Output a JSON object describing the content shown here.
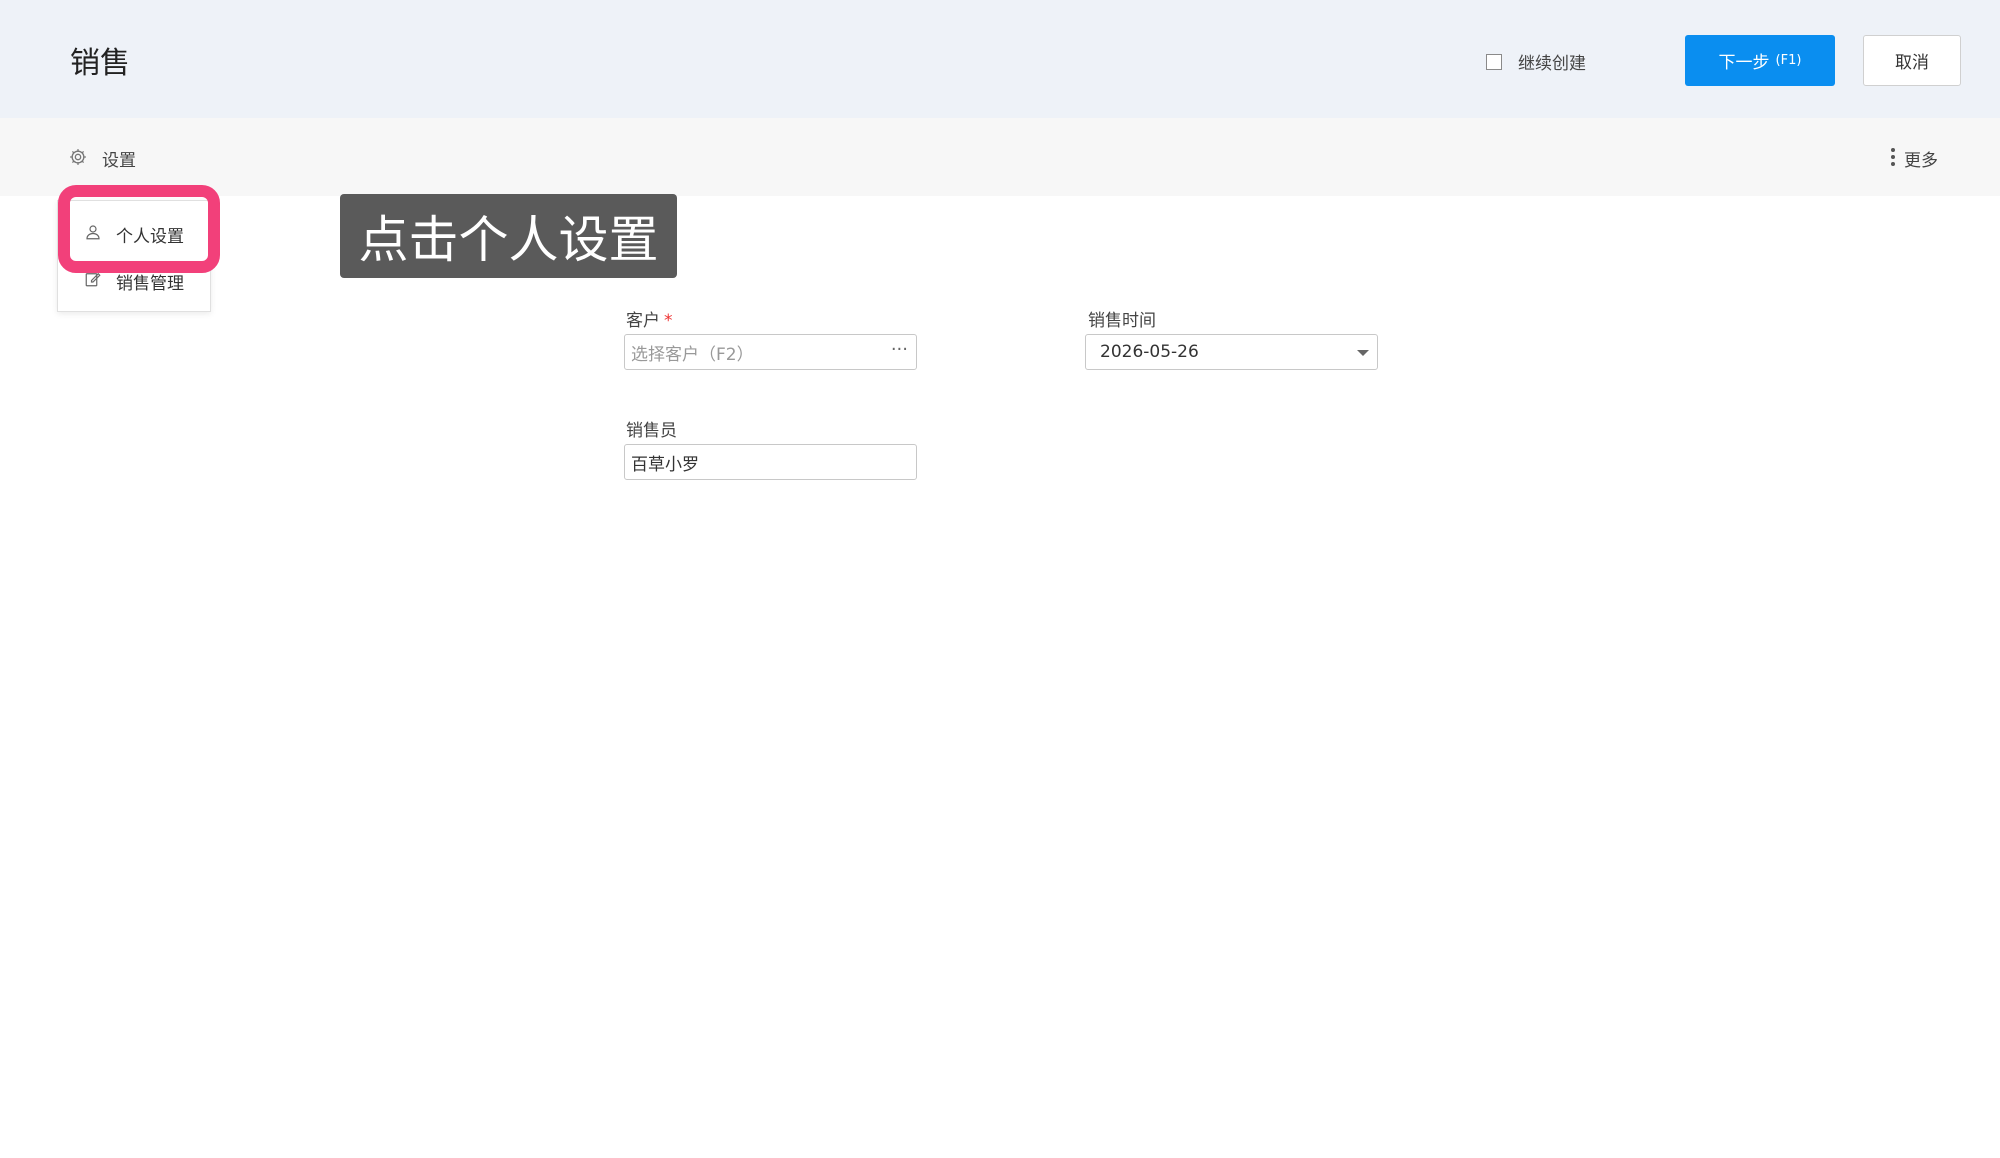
{
  "header": {
    "title": "销售",
    "continue_create": "继续创建",
    "next_label": "下一步",
    "next_shortcut": "(F1)",
    "cancel_label": "取消"
  },
  "toolbar": {
    "settings_label": "设置",
    "more_label": "更多"
  },
  "dropdown": {
    "items": [
      {
        "label": "个人设置"
      },
      {
        "label": "销售管理"
      }
    ]
  },
  "tooltip": {
    "text": "点击个人设置"
  },
  "form": {
    "customer": {
      "label": "客户",
      "required_mark": "*",
      "placeholder": "选择客户（F2）",
      "more": "···"
    },
    "sale_time": {
      "label": "销售时间",
      "value": "2026-05-26"
    },
    "salesperson": {
      "label": "销售员",
      "value": "百草小罗"
    }
  },
  "colors": {
    "primary": "#0a8ef0",
    "highlight": "#f2407a",
    "header_bg": "#eef2f8",
    "toolbar_bg": "#f7f7f7"
  }
}
